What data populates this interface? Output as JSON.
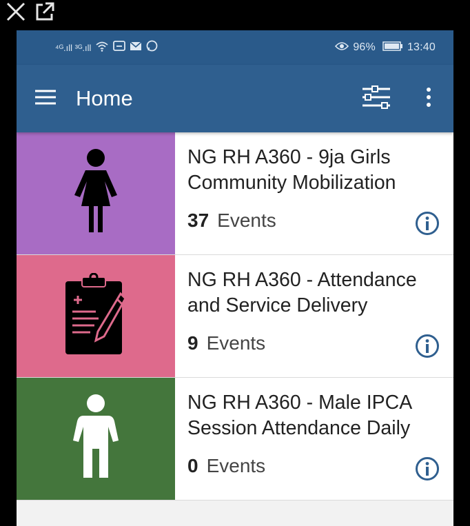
{
  "overlay": {
    "close_icon": "close-icon",
    "external_icon": "open-external-icon"
  },
  "status_bar": {
    "left_icons": [
      "signal-4g-icon",
      "signal-3g-icon",
      "wifi-icon",
      "messenger-icon",
      "mail-icon",
      "whatsapp-icon"
    ],
    "left_text": "⁴ᴳ.ıll ³ᴳ.ıll",
    "battery": "96%",
    "time": "13:40"
  },
  "app_bar": {
    "title": "Home",
    "menu_icon": "hamburger-menu-icon",
    "filter_icon": "filter-sliders-icon",
    "more_icon": "more-vertical-icon"
  },
  "programs": [
    {
      "name": "NG RH A360 - 9ja Girls Community Mobilization",
      "count": "37",
      "events_label": "Events",
      "tile_color": "#a86cc4",
      "icon": "female-person-icon"
    },
    {
      "name": "NG RH A360 - Attendance and Service Delivery",
      "count": "9",
      "events_label": "Events",
      "tile_color": "#de6a8c",
      "icon": "clipboard-pencil-icon"
    },
    {
      "name": "NG RH A360 - Male IPCA Session Attendance Daily",
      "count": "0",
      "events_label": "Events",
      "tile_color": "#44763c",
      "icon": "male-person-icon"
    }
  ],
  "colors": {
    "status_bar": "#2a5a8a",
    "app_bar": "#2f5f8f",
    "info_icon": "#2f5f8f"
  }
}
